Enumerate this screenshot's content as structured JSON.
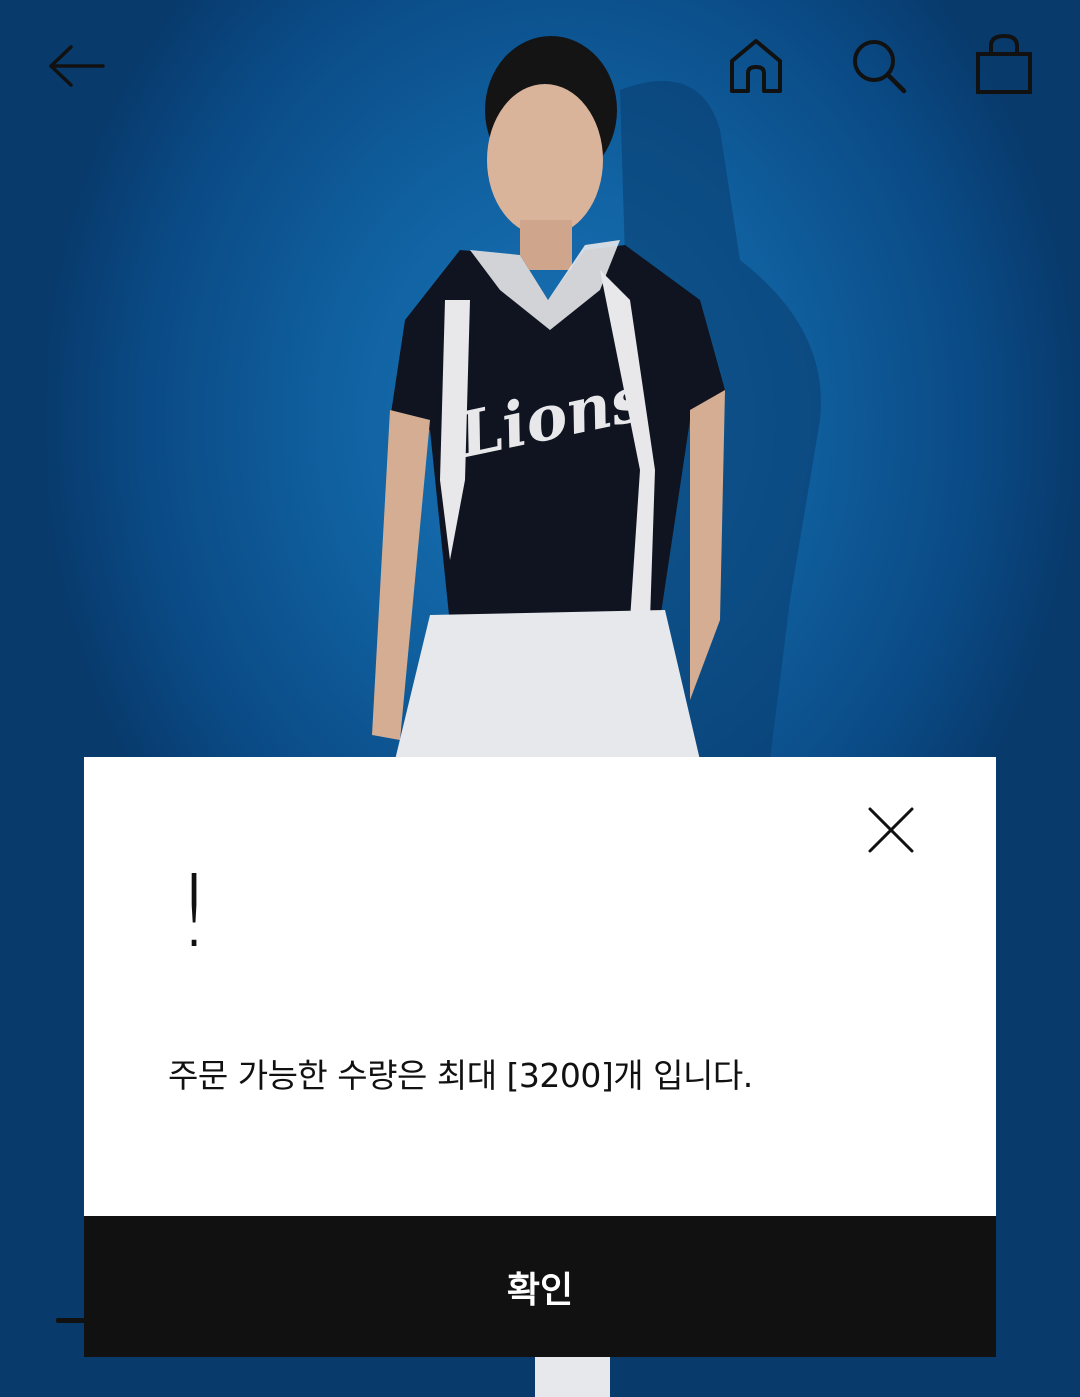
{
  "header": {
    "back_icon": "arrow-left-icon",
    "home_icon": "home-icon",
    "search_icon": "search-icon",
    "cart_icon": "shopping-bag-icon"
  },
  "product_image": {
    "shirt_text": "Lions",
    "background_color": "#1a74b8"
  },
  "dialog": {
    "alert_mark": "!",
    "message": "주문 가능한 수량은 최대 [3200]개 입니다.",
    "confirm_label": "확인",
    "close_icon": "close-icon"
  },
  "colors": {
    "button_bg": "#111111",
    "dialog_bg": "#ffffff"
  }
}
